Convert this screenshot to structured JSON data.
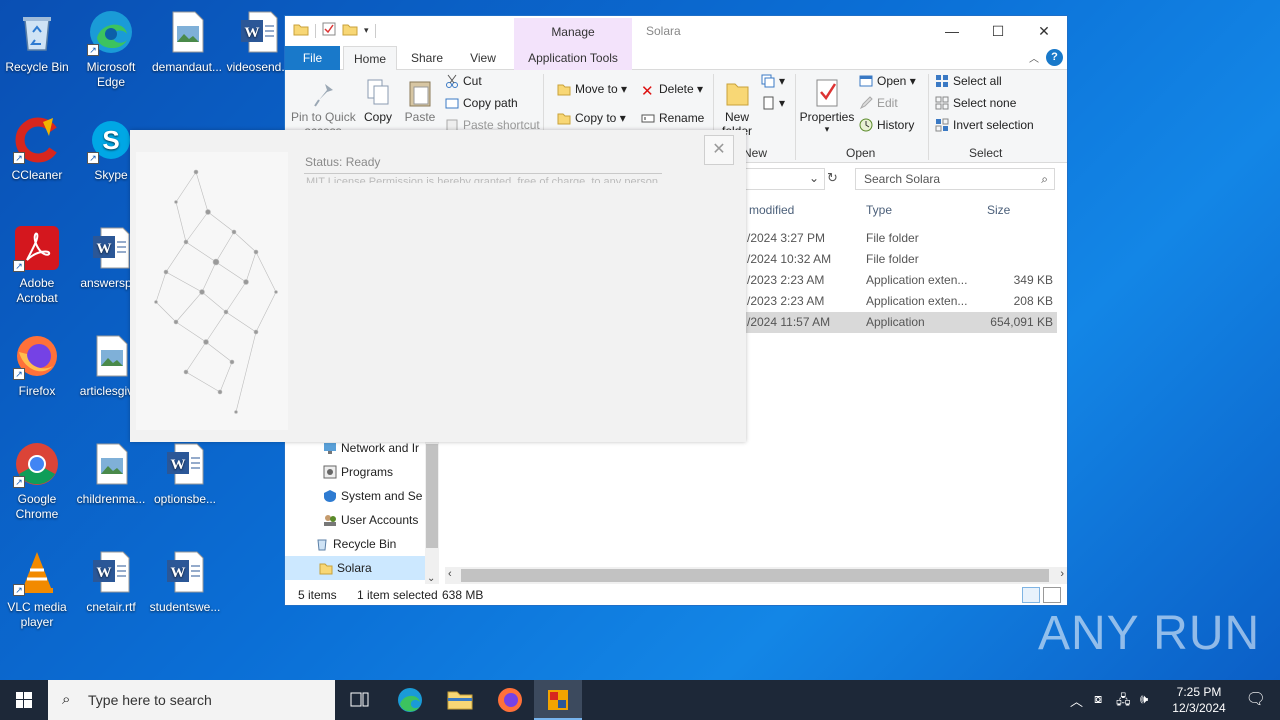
{
  "desktop": {
    "icons": [
      {
        "label": "Recycle Bin"
      },
      {
        "label": "Microsoft Edge"
      },
      {
        "label": "demandaut..."
      },
      {
        "label": "videosend..."
      },
      {
        "label": "CCleaner"
      },
      {
        "label": "Skype"
      },
      {
        "label": "Adobe Acrobat"
      },
      {
        "label": "answersp..."
      },
      {
        "label": "Firefox"
      },
      {
        "label": "articlesgiv..."
      },
      {
        "label": "Google Chrome"
      },
      {
        "label": "childrenma..."
      },
      {
        "label": "optionsbe..."
      },
      {
        "label": "VLC media player"
      },
      {
        "label": "cnetair.rtf"
      },
      {
        "label": "studentswe..."
      }
    ]
  },
  "explorer": {
    "title": "Solara",
    "manage_label": "Manage",
    "tabs": {
      "file": "File",
      "home": "Home",
      "share": "Share",
      "view": "View",
      "app_tools": "Application Tools"
    },
    "ribbon": {
      "pin": "Pin to Quick",
      "pin2": "access",
      "copy": "Copy",
      "paste": "Paste",
      "cut": "Cut",
      "copy_path": "Copy path",
      "paste_shortcut": "Paste shortcut",
      "move_to": "Move to",
      "copy_to": "Copy to",
      "delete": "Delete",
      "rename": "Rename",
      "new_folder": "New",
      "new_folder2": "folder",
      "new_group": "New",
      "properties": "Properties",
      "open": "Open",
      "edit": "Edit",
      "history": "History",
      "open_group": "Open",
      "select_all": "Select all",
      "select_none": "Select none",
      "invert_selection": "Invert selection",
      "select_group": "Select"
    },
    "search_placeholder": "Search Solara",
    "columns": {
      "modified": "modified",
      "type": "Type",
      "size": "Size"
    },
    "files": [
      {
        "date": "/2024 3:27 PM",
        "type": "File folder",
        "size": ""
      },
      {
        "date": "/2024 10:32 AM",
        "type": "File folder",
        "size": ""
      },
      {
        "date": "/2023 2:23 AM",
        "type": "Application exten...",
        "size": "349 KB"
      },
      {
        "date": "/2023 2:23 AM",
        "type": "Application exten...",
        "size": "208 KB"
      },
      {
        "date": "/2024 11:57 AM",
        "type": "Application",
        "size": "654,091 KB"
      }
    ],
    "nav": [
      {
        "label": "Network and Ir"
      },
      {
        "label": "Programs"
      },
      {
        "label": "System and Se"
      },
      {
        "label": "User Accounts"
      },
      {
        "label": "Recycle Bin"
      },
      {
        "label": "Solara"
      }
    ],
    "status": {
      "items": "5 items",
      "selected": "1 item selected",
      "size": "638 MB"
    }
  },
  "splash": {
    "status": "Status: Ready",
    "faded_text": "MIT License Permission is hereby granted, free of charge, to any person"
  },
  "taskbar": {
    "search_placeholder": "Type here to search",
    "time": "7:25 PM",
    "date": "12/3/2024"
  },
  "watermark": "ANY RUN"
}
